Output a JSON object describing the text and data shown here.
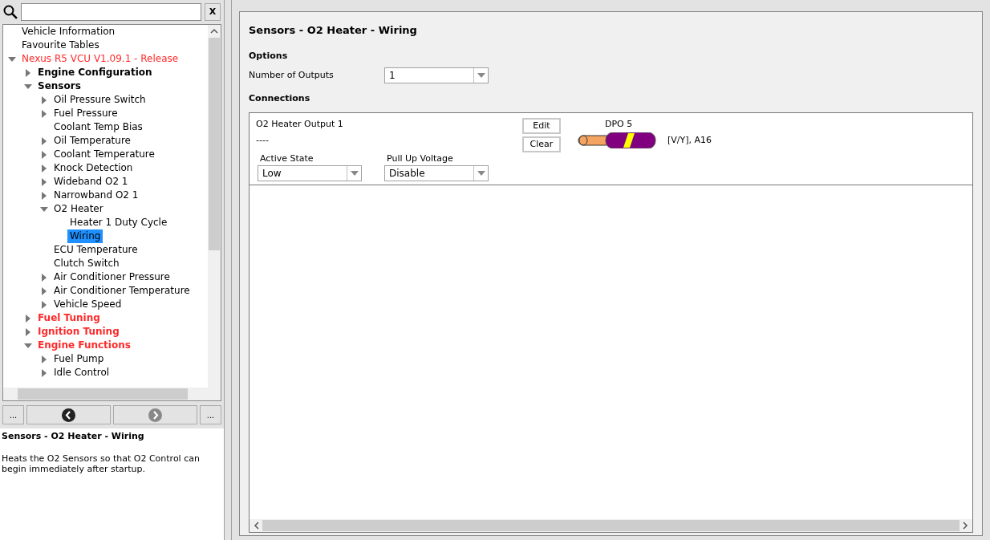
{
  "search": {
    "button": "X"
  },
  "tree": [
    {
      "label": "Vehicle Information",
      "selected": false
    },
    {
      "label": "Favourite Tables",
      "selected": false
    },
    {
      "label": "Nexus R5 VCU V1.09.1 - Release",
      "selected": false,
      "color": "#ff2a2a",
      "expanded": true,
      "children": [
        {
          "label": "Engine Configuration",
          "selected": false,
          "bold": true,
          "expanded": false
        },
        {
          "label": "Sensors",
          "selected": false,
          "bold": true,
          "expanded": true,
          "children": [
            {
              "label": "Oil Pressure Switch",
              "selected": false,
              "expanded": false
            },
            {
              "label": "Fuel Pressure",
              "selected": false,
              "expanded": false
            },
            {
              "label": "Coolant Temp Bias",
              "selected": false
            },
            {
              "label": "Oil Temperature",
              "selected": false,
              "expanded": false
            },
            {
              "label": "Coolant Temperature",
              "selected": false,
              "expanded": false
            },
            {
              "label": "Knock Detection",
              "selected": false,
              "expanded": false
            },
            {
              "label": "Wideband O2 1",
              "selected": false,
              "expanded": false
            },
            {
              "label": "Narrowband O2 1",
              "selected": false,
              "expanded": false
            },
            {
              "label": "O2 Heater",
              "selected": false,
              "expanded": true,
              "children": [
                {
                  "label": "Heater 1 Duty Cycle",
                  "selected": false
                },
                {
                  "label": "Wiring",
                  "selected": true
                }
              ]
            },
            {
              "label": "ECU Temperature",
              "selected": false
            },
            {
              "label": "Clutch Switch",
              "selected": false
            },
            {
              "label": "Air Conditioner Pressure",
              "selected": false,
              "expanded": false
            },
            {
              "label": "Air Conditioner Temperature",
              "selected": false,
              "expanded": false
            },
            {
              "label": "Vehicle Speed",
              "selected": false,
              "expanded": false
            }
          ]
        },
        {
          "label": "Fuel Tuning",
          "selected": false,
          "bold": true,
          "color": "#ff2a2a",
          "expanded": false
        },
        {
          "label": "Ignition Tuning",
          "selected": false,
          "bold": true,
          "color": "#ff2a2a",
          "expanded": false
        },
        {
          "label": "Engine Functions",
          "selected": false,
          "bold": true,
          "color": "#ff2a2a",
          "expanded": true,
          "children": [
            {
              "label": "Fuel Pump",
              "selected": false,
              "expanded": false
            },
            {
              "label": "Idle Control",
              "selected": false,
              "expanded": false
            }
          ]
        }
      ]
    }
  ],
  "nav": {
    "left_more": "...",
    "back_disabled": false,
    "forward_disabled": true,
    "right_more": "..."
  },
  "help": {
    "title": "Sensors - O2 Heater - Wiring",
    "text": "Heats the O2 Sensors so that O2 Control can begin immediately after startup."
  },
  "page": {
    "title": "Sensors - O2 Heater - Wiring",
    "options_heading": "Options",
    "outputs_label": "Number of Outputs",
    "outputs_value": "1",
    "connections_heading": "Connections",
    "connection": {
      "name": "O2 Heater Output 1",
      "value": "----",
      "edit": "Edit",
      "clear": "Clear",
      "pin": "DPO 5",
      "wire": "[V/Y], A16",
      "fields": [
        {
          "label": "Active State",
          "value": "Low"
        },
        {
          "label": "Pull Up Voltage",
          "value": "Disable"
        }
      ]
    }
  }
}
